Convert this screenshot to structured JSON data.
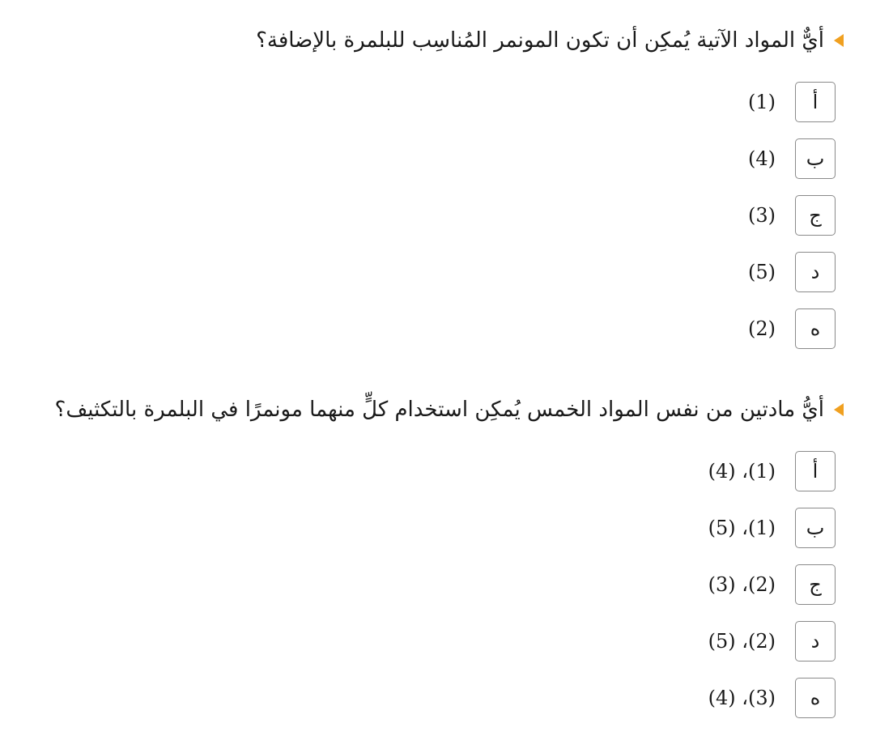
{
  "questions": [
    {
      "text": "أيٌّ المواد الآتية يُمكِن أن تكون المونمر المُناسِب للبلمرة بالإضافة؟",
      "options": [
        {
          "letter": "أ",
          "text": "(1)"
        },
        {
          "letter": "ب",
          "text": "(4)"
        },
        {
          "letter": "ج",
          "text": "(3)"
        },
        {
          "letter": "د",
          "text": "(5)"
        },
        {
          "letter": "ه",
          "text": "(2)"
        }
      ]
    },
    {
      "text": "أيُّ مادتين من نفس المواد الخمس يُمكِن استخدام كلٍّ منهما مونمرًا في البلمرة بالتكثيف؟",
      "options": [
        {
          "letter": "أ",
          "text": "(1)، (4)"
        },
        {
          "letter": "ب",
          "text": "(1)، (5)"
        },
        {
          "letter": "ج",
          "text": "(2)، (3)"
        },
        {
          "letter": "د",
          "text": "(2)، (5)"
        },
        {
          "letter": "ه",
          "text": "(3)، (4)"
        }
      ]
    }
  ],
  "colors": {
    "marker": "#f0a020",
    "box_border": "#8a8a8a"
  },
  "icons": {
    "marker": "triangle-marker-icon"
  }
}
